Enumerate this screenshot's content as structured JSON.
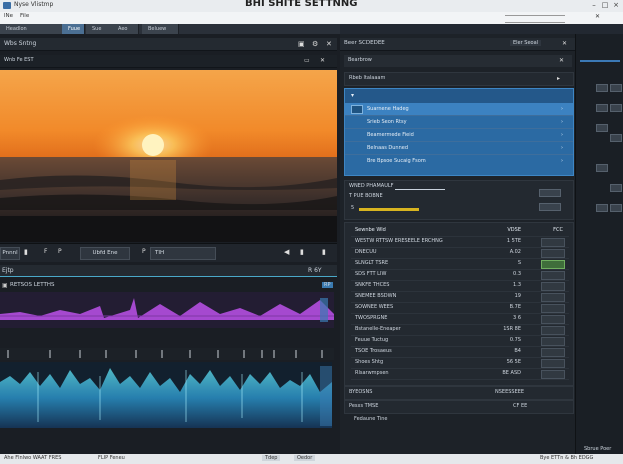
{
  "window": {
    "app_name": "Nyse Vlistmp",
    "title": "BHI SHITE SETTNNG"
  },
  "menu": [
    "lNe",
    "File"
  ],
  "doc_tabs": [
    "Headlon",
    "Fuue",
    "Sue",
    "Aeo",
    "Beluew"
  ],
  "left_panel": {
    "title": "Wbs Sntng",
    "subtitle": "Wnb Fe EST",
    "header_icons": [
      "video-icon",
      "settings-icon",
      "close-icon"
    ]
  },
  "playback": {
    "time_left": "Pnnnl",
    "marker_1": "F",
    "marker_2": "P",
    "timecode": "Ubfd Ene",
    "field_1": "P",
    "field_2": "TIH"
  },
  "track_header": {
    "label": "Ejtp",
    "right_label": "R 6Y"
  },
  "track_1": {
    "label": "RETSOS LETTHS",
    "right_tag": "RP"
  },
  "right_panel": {
    "title": "Beer SCDEDEE",
    "tab_label": "Eler Seoal",
    "row_title": "Bearbrow",
    "source_section": "Rbeb ltalaaam",
    "list_items": [
      "Suarnene Hadeg",
      "Srieb Seon Rtsy",
      "Beamermede Fieid",
      "Belnaas Dunned",
      "Bre Bpsoe Sucaig Fsom"
    ],
    "props_title": "WNED PHAMAULF",
    "props_sub": "T PUE BOBNE",
    "props_field": "5",
    "table_header": {
      "name": "Sewnbe Wld",
      "value": "VDSE",
      "icons": "FCC"
    },
    "rows": [
      {
        "name": "WE5TW RTTSW ERESEELE ERCHNG",
        "value": "1 5TE"
      },
      {
        "name": "DNECUU",
        "value": "A.02"
      },
      {
        "name": "SLNGLT TSRE",
        "value": "S"
      },
      {
        "name": "SDS FTT LIW",
        "value": "0.3"
      },
      {
        "name": "SNKFE THCES",
        "value": "1.3"
      },
      {
        "name": "SNEMEE BSDWN",
        "value": "19"
      },
      {
        "name": "SOWNEE WEES",
        "value": "B.7E"
      },
      {
        "name": "TWOSPRGNE",
        "value": "3 6"
      },
      {
        "name": "Bstanelle-Eneaper",
        "value": "1SR 8E"
      },
      {
        "name": "Feuue Tuctug",
        "value": "0.7S"
      },
      {
        "name": "TSOE Trosaeus",
        "value": "B4"
      },
      {
        "name": "Shoes Shtg",
        "value": "56 5E"
      },
      {
        "name": "Rlsarwmpsen",
        "value": "BE ASD"
      },
      {
        "name": "Pesxs TMSE",
        "value": "CF EE"
      }
    ],
    "footer_row": {
      "name": "BYEOSNS",
      "value": "NSEESSEEE"
    },
    "footer_label": "Fedaune Tine"
  },
  "far_right": {
    "title": "Sbrue Poer"
  },
  "status": {
    "left": "Ahe Flnlwo WAAT FRES",
    "mid": "FLIP Feneu",
    "b1": "Tdep",
    "b2": "Oedor",
    "right": "Bye ETTn & Bh EDGG"
  },
  "colors": {
    "accent": "#3b79b6",
    "list_bg": "#2d6ea8",
    "purple_wave": "#b34de0",
    "teal_wave": "#2ec1d6",
    "sky_top": "#f5a142",
    "sky_bottom": "#2b2320"
  }
}
